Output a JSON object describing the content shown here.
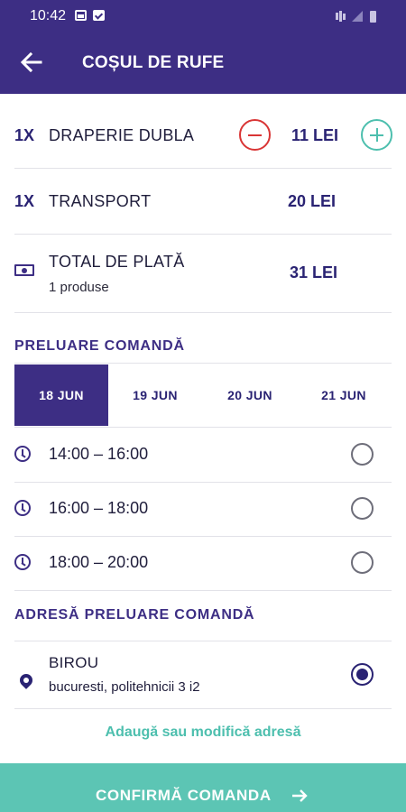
{
  "status_bar": {
    "time": "10:42"
  },
  "header": {
    "title": "COȘUL DE RUFE"
  },
  "cart": {
    "items": [
      {
        "qty": "1X",
        "name": "DRAPERIE DUBLA",
        "price": "11 LEI"
      },
      {
        "qty": "1X",
        "name": "TRANSPORT",
        "price": "20 LEI"
      }
    ],
    "total": {
      "label": "TOTAL DE PLATĂ",
      "subtitle": "1 produse",
      "price": "31 LEI"
    }
  },
  "pickup": {
    "title": "PRELUARE COMANDĂ",
    "days": [
      "18 JUN",
      "19 JUN",
      "20 JUN",
      "21 JUN"
    ],
    "selected_day": "18 JUN",
    "slots": [
      "14:00 – 16:00",
      "16:00 – 18:00",
      "18:00 – 20:00"
    ]
  },
  "address": {
    "title": "ADRESĂ PRELUARE COMANDĂ",
    "name": "BIROU",
    "line": "bucuresti, politehnicii 3 i2",
    "selected": true,
    "edit_link": "Adaugă sau modifică adresă"
  },
  "confirm": {
    "label": "CONFIRMĂ COMANDA"
  },
  "colors": {
    "primary": "#3d2e84",
    "accent": "#5cc5b4",
    "remove": "#d93535"
  }
}
